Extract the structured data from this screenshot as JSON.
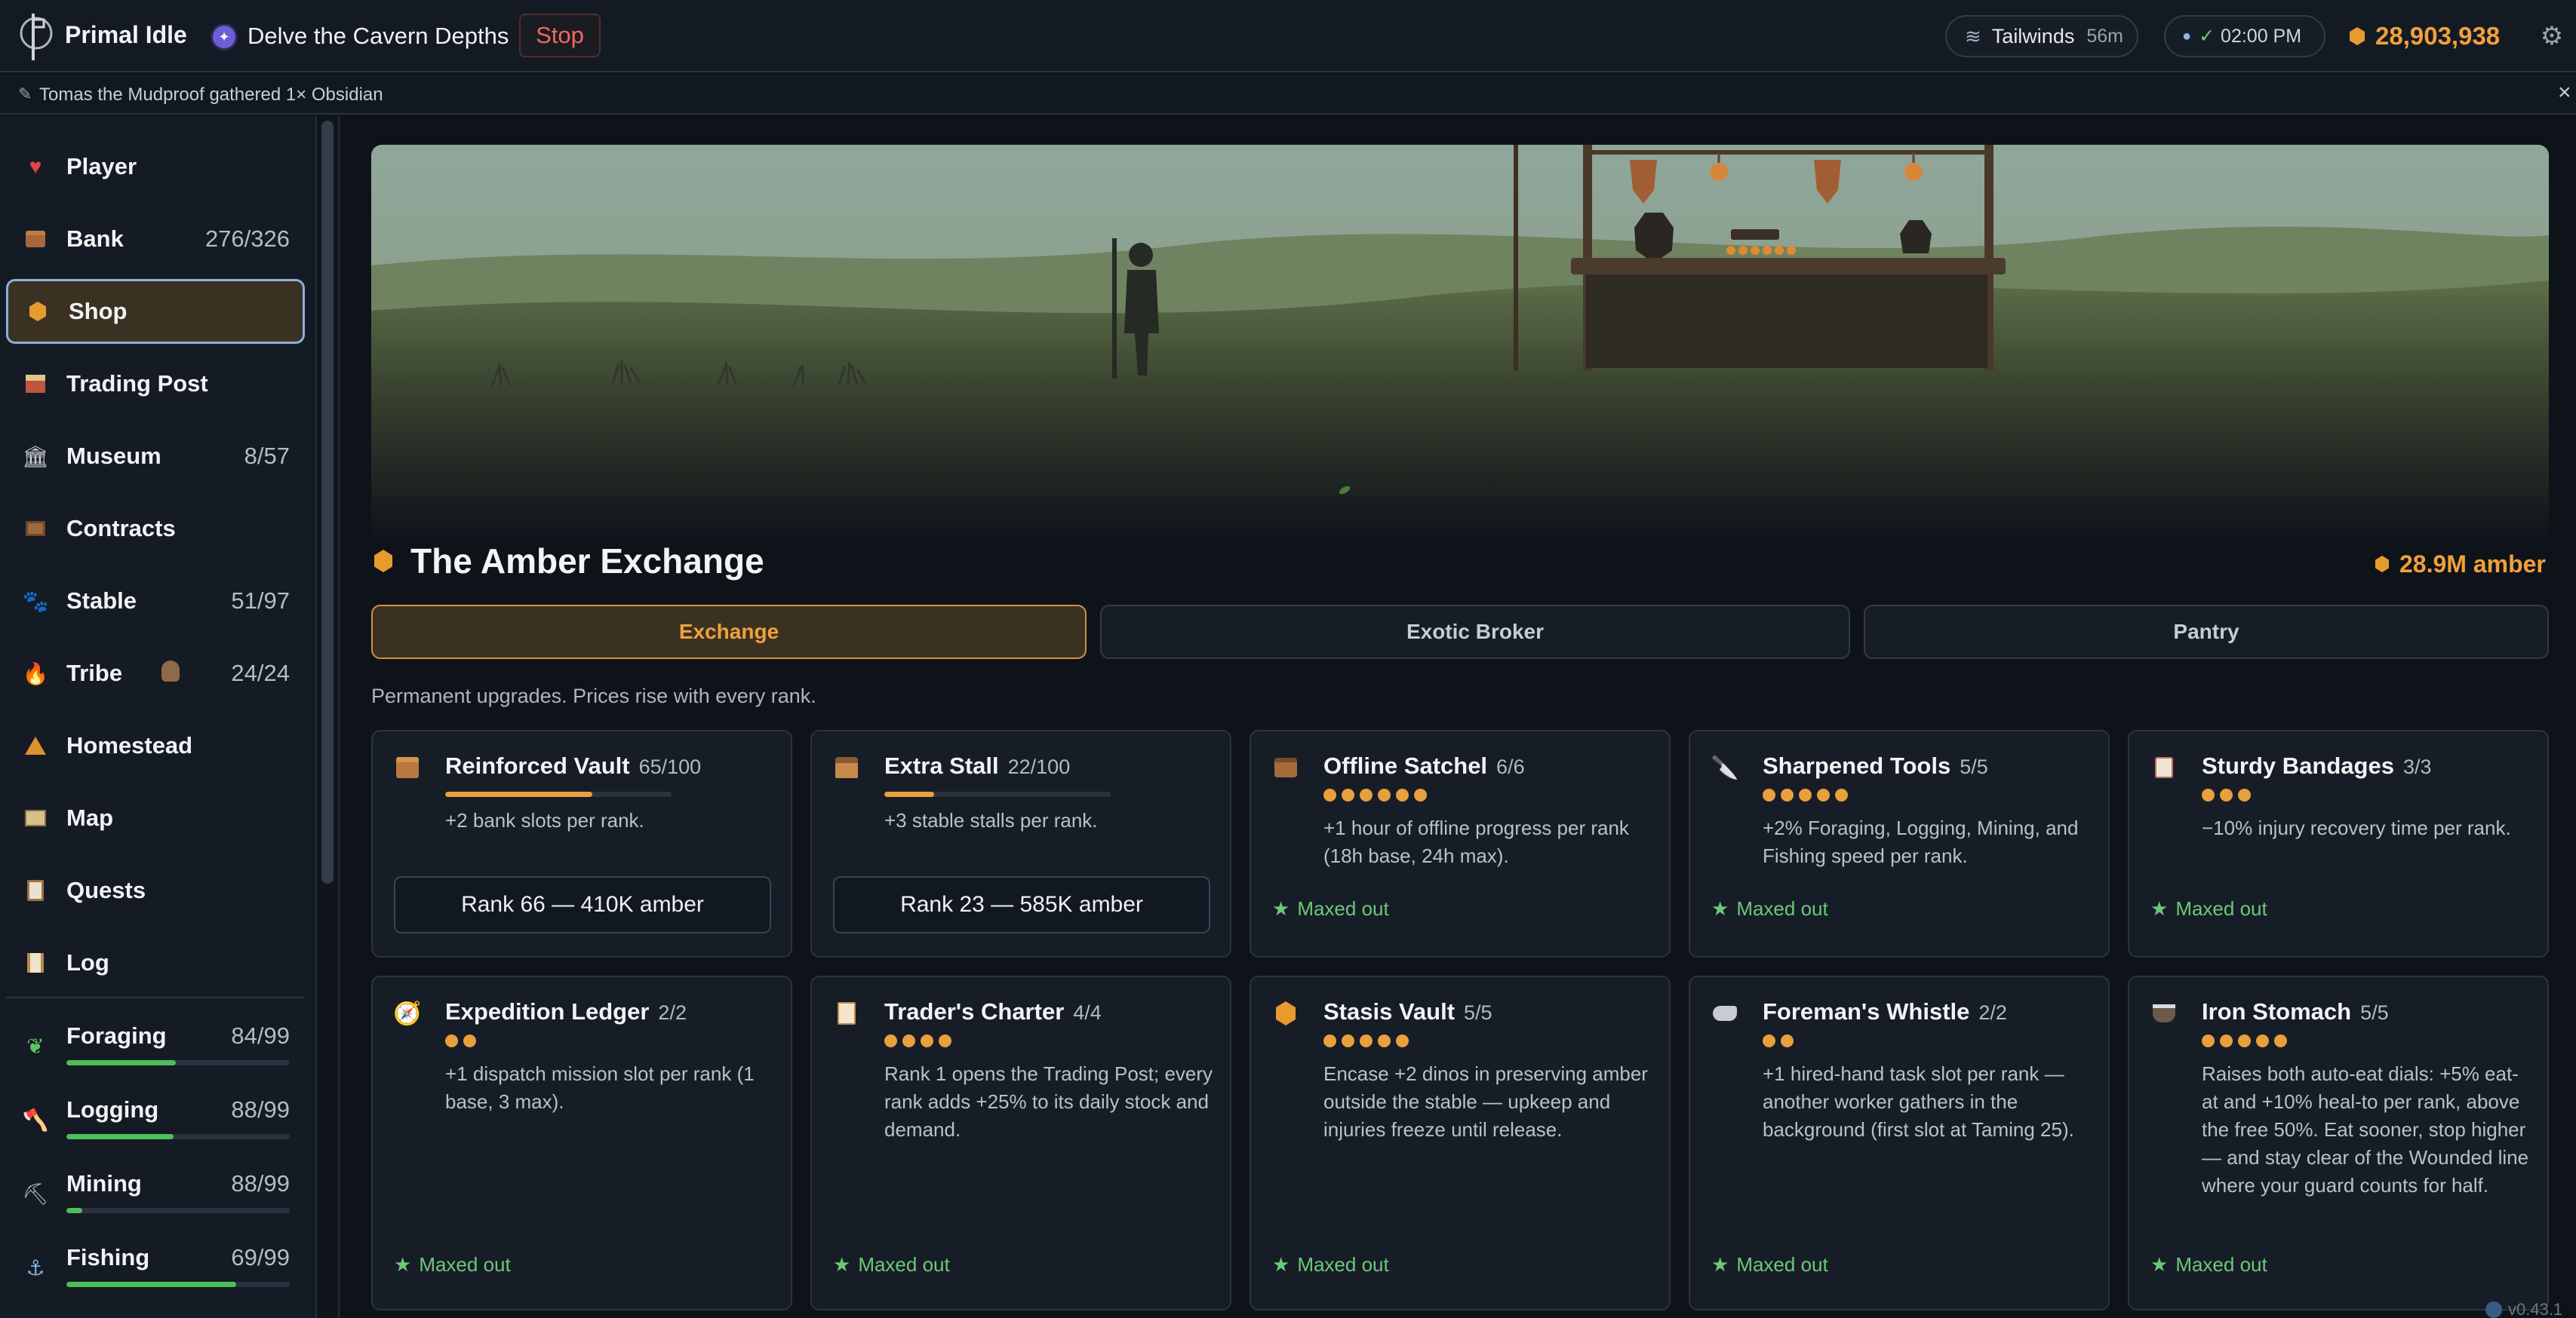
{
  "app": {
    "title": "Primal Idle"
  },
  "activity": {
    "title": "Delve the Cavern Depths",
    "stop_label": "Stop"
  },
  "status": {
    "wind_label": "Tailwinds",
    "wind_time": "56m",
    "clock_time": "02:00 PM",
    "amber_total": "28,903,938"
  },
  "notification": {
    "text": "Tomas the Mudproof gathered 1× Obsidian"
  },
  "sidebar": {
    "items": [
      {
        "label": "Player",
        "count": ""
      },
      {
        "label": "Bank",
        "count": "276/326"
      },
      {
        "label": "Shop",
        "count": ""
      },
      {
        "label": "Trading Post",
        "count": ""
      },
      {
        "label": "Museum",
        "count": "8/57"
      },
      {
        "label": "Contracts",
        "count": ""
      },
      {
        "label": "Stable",
        "count": "51/97"
      },
      {
        "label": "Tribe",
        "count": "24/24"
      },
      {
        "label": "Homestead",
        "count": ""
      },
      {
        "label": "Map",
        "count": ""
      },
      {
        "label": "Quests",
        "count": ""
      },
      {
        "label": "Log",
        "count": ""
      }
    ],
    "skills": [
      {
        "label": "Foraging",
        "level": "84/99",
        "progress": 0.49
      },
      {
        "label": "Logging",
        "level": "88/99",
        "progress": 0.48
      },
      {
        "label": "Mining",
        "level": "88/99",
        "progress": 0.07
      },
      {
        "label": "Fishing",
        "level": "69/99",
        "progress": 0.76
      }
    ]
  },
  "shop": {
    "title": "The Amber Exchange",
    "amber": "28.9M amber",
    "tabs": [
      "Exchange",
      "Exotic Broker",
      "Pantry"
    ],
    "active_tab": "Exchange",
    "note": "Permanent upgrades. Prices rise with every rank.",
    "maxed_label": "Maxed out",
    "cards": [
      {
        "title": "Reinforced Vault",
        "rank": "65/100",
        "progress": 0.65,
        "desc": "+2 bank slots per rank.",
        "button": "Rank 66 — 410K amber"
      },
      {
        "title": "Extra Stall",
        "rank": "22/100",
        "progress": 0.22,
        "desc": "+3 stable stalls per rank.",
        "button": "Rank 23 — 585K amber"
      },
      {
        "title": "Offline Satchel",
        "rank": "6/6",
        "dots": 6,
        "desc": "+1 hour of offline progress per rank (18h base, 24h max)."
      },
      {
        "title": "Sharpened Tools",
        "rank": "5/5",
        "dots": 5,
        "desc": "+2% Foraging, Logging, Mining, and Fishing speed per rank."
      },
      {
        "title": "Sturdy Bandages",
        "rank": "3/3",
        "dots": 3,
        "desc": "−10% injury recovery time per rank."
      },
      {
        "title": "Expedition Ledger",
        "rank": "2/2",
        "dots": 2,
        "desc": "+1 dispatch mission slot per rank (1 base, 3 max)."
      },
      {
        "title": "Trader's Charter",
        "rank": "4/4",
        "dots": 4,
        "desc": "Rank 1 opens the Trading Post; every rank adds +25% to its daily stock and demand."
      },
      {
        "title": "Stasis Vault",
        "rank": "5/5",
        "dots": 5,
        "desc": "Encase +2 dinos in preserving amber outside the stable — upkeep and injuries freeze until release."
      },
      {
        "title": "Foreman's Whistle",
        "rank": "2/2",
        "dots": 2,
        "desc": "+1 hired-hand task slot per rank — another worker gathers in the background (first slot at Taming 25)."
      },
      {
        "title": "Iron Stomach",
        "rank": "5/5",
        "dots": 5,
        "desc": "Raises both auto-eat dials: +5% eat-at and +10% heal-to per rank, above the free 50%. Eat sooner, stop higher — and stay clear of the Wounded line where your guard counts for half."
      }
    ]
  },
  "version": "v0.43.1",
  "colors": {
    "accent": "#e8a03c",
    "success": "#6cc978",
    "danger": "#ef6a5f",
    "active_border": "#8fb0d8"
  }
}
